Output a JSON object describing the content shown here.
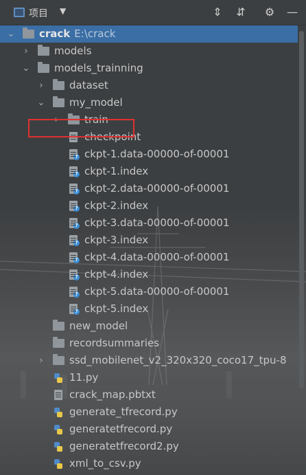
{
  "header": {
    "title": "项目",
    "dropdown_glyph": "▼",
    "buttons": [
      {
        "name": "expand-all-icon",
        "glyph": "⇕"
      },
      {
        "name": "collapse-all-icon",
        "glyph": "⇵"
      },
      {
        "name": "gear-icon",
        "glyph": "⚙"
      },
      {
        "name": "minimize-icon",
        "glyph": "—"
      }
    ]
  },
  "tree": {
    "root": {
      "label": "crack",
      "path": "E:\\crack"
    },
    "items": [
      {
        "label": "models",
        "type": "folder",
        "level": 1,
        "expanded": false
      },
      {
        "label": "models_trainning",
        "type": "folder",
        "level": 1,
        "expanded": true
      },
      {
        "label": "dataset",
        "type": "folder",
        "level": 2,
        "expanded": false
      },
      {
        "label": "my_model",
        "type": "folder",
        "level": 2,
        "expanded": true
      },
      {
        "label": "train",
        "type": "folder",
        "level": 3,
        "expanded": false
      },
      {
        "label": "checkpoint",
        "type": "file",
        "level": 3
      },
      {
        "label": "ckpt-1.data-00000-of-00001",
        "type": "unknown",
        "level": 3
      },
      {
        "label": "ckpt-1.index",
        "type": "unknown",
        "level": 3
      },
      {
        "label": "ckpt-2.data-00000-of-00001",
        "type": "unknown",
        "level": 3
      },
      {
        "label": "ckpt-2.index",
        "type": "unknown",
        "level": 3
      },
      {
        "label": "ckpt-3.data-00000-of-00001",
        "type": "unknown",
        "level": 3
      },
      {
        "label": "ckpt-3.index",
        "type": "unknown",
        "level": 3
      },
      {
        "label": "ckpt-4.data-00000-of-00001",
        "type": "unknown",
        "level": 3
      },
      {
        "label": "ckpt-4.index",
        "type": "unknown",
        "level": 3
      },
      {
        "label": "ckpt-5.data-00000-of-00001",
        "type": "unknown",
        "level": 3
      },
      {
        "label": "ckpt-5.index",
        "type": "unknown",
        "level": 3
      },
      {
        "label": "new_model",
        "type": "folder",
        "level": 2
      },
      {
        "label": "recordsummaries",
        "type": "folder",
        "level": 2
      },
      {
        "label": "ssd_mobilenet_v2_320x320_coco17_tpu-8",
        "type": "folder",
        "level": 2,
        "expanded": false
      },
      {
        "label": "11.py",
        "type": "python",
        "level": 2
      },
      {
        "label": "crack_map.pbtxt",
        "type": "file",
        "level": 2
      },
      {
        "label": "generate_tfrecord.py",
        "type": "python",
        "level": 2
      },
      {
        "label": "generatetfrecord.py",
        "type": "python",
        "level": 2
      },
      {
        "label": "generatetfrecord2.py",
        "type": "python",
        "level": 2
      },
      {
        "label": "xml_to_csv.py",
        "type": "python",
        "level": 2
      }
    ]
  },
  "colors": {
    "selection": "#3a6ea5",
    "highlight_border": "#e03030",
    "background": "#3c3f41"
  }
}
